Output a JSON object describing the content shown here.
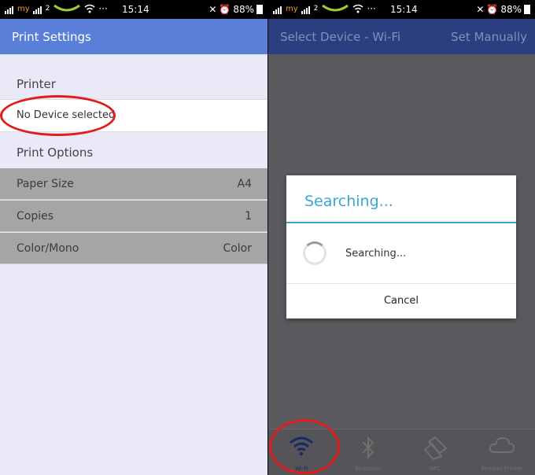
{
  "status_bar": {
    "time": "15:14",
    "battery": "88%",
    "carrier": "my",
    "network": "2"
  },
  "left": {
    "header": {
      "title": "Print Settings"
    },
    "printer_section": "Printer",
    "device": "No Device selected",
    "options_section": "Print Options",
    "options": [
      {
        "label": "Paper Size",
        "value": "A4"
      },
      {
        "label": "Copies",
        "value": "1"
      },
      {
        "label": "Color/Mono",
        "value": "Color"
      }
    ]
  },
  "right": {
    "header": {
      "title": "Select Device - Wi-Fi",
      "action": "Set Manually"
    },
    "dialog": {
      "title": "Searching...",
      "message": "Searching...",
      "cancel": "Cancel"
    },
    "tabs": [
      {
        "label": "Wi-Fi",
        "icon": "wifi-icon"
      },
      {
        "label": "Bluetooth",
        "icon": "bluetooth-icon"
      },
      {
        "label": "NFC",
        "icon": "nfc-icon"
      },
      {
        "label": "Remote Printer",
        "icon": "cloud-icon"
      }
    ]
  },
  "colors": {
    "header_left": "#5a7fd9",
    "header_right": "#2b3f80",
    "accent": "#3aa6d6",
    "highlight": "#e21c1c"
  }
}
